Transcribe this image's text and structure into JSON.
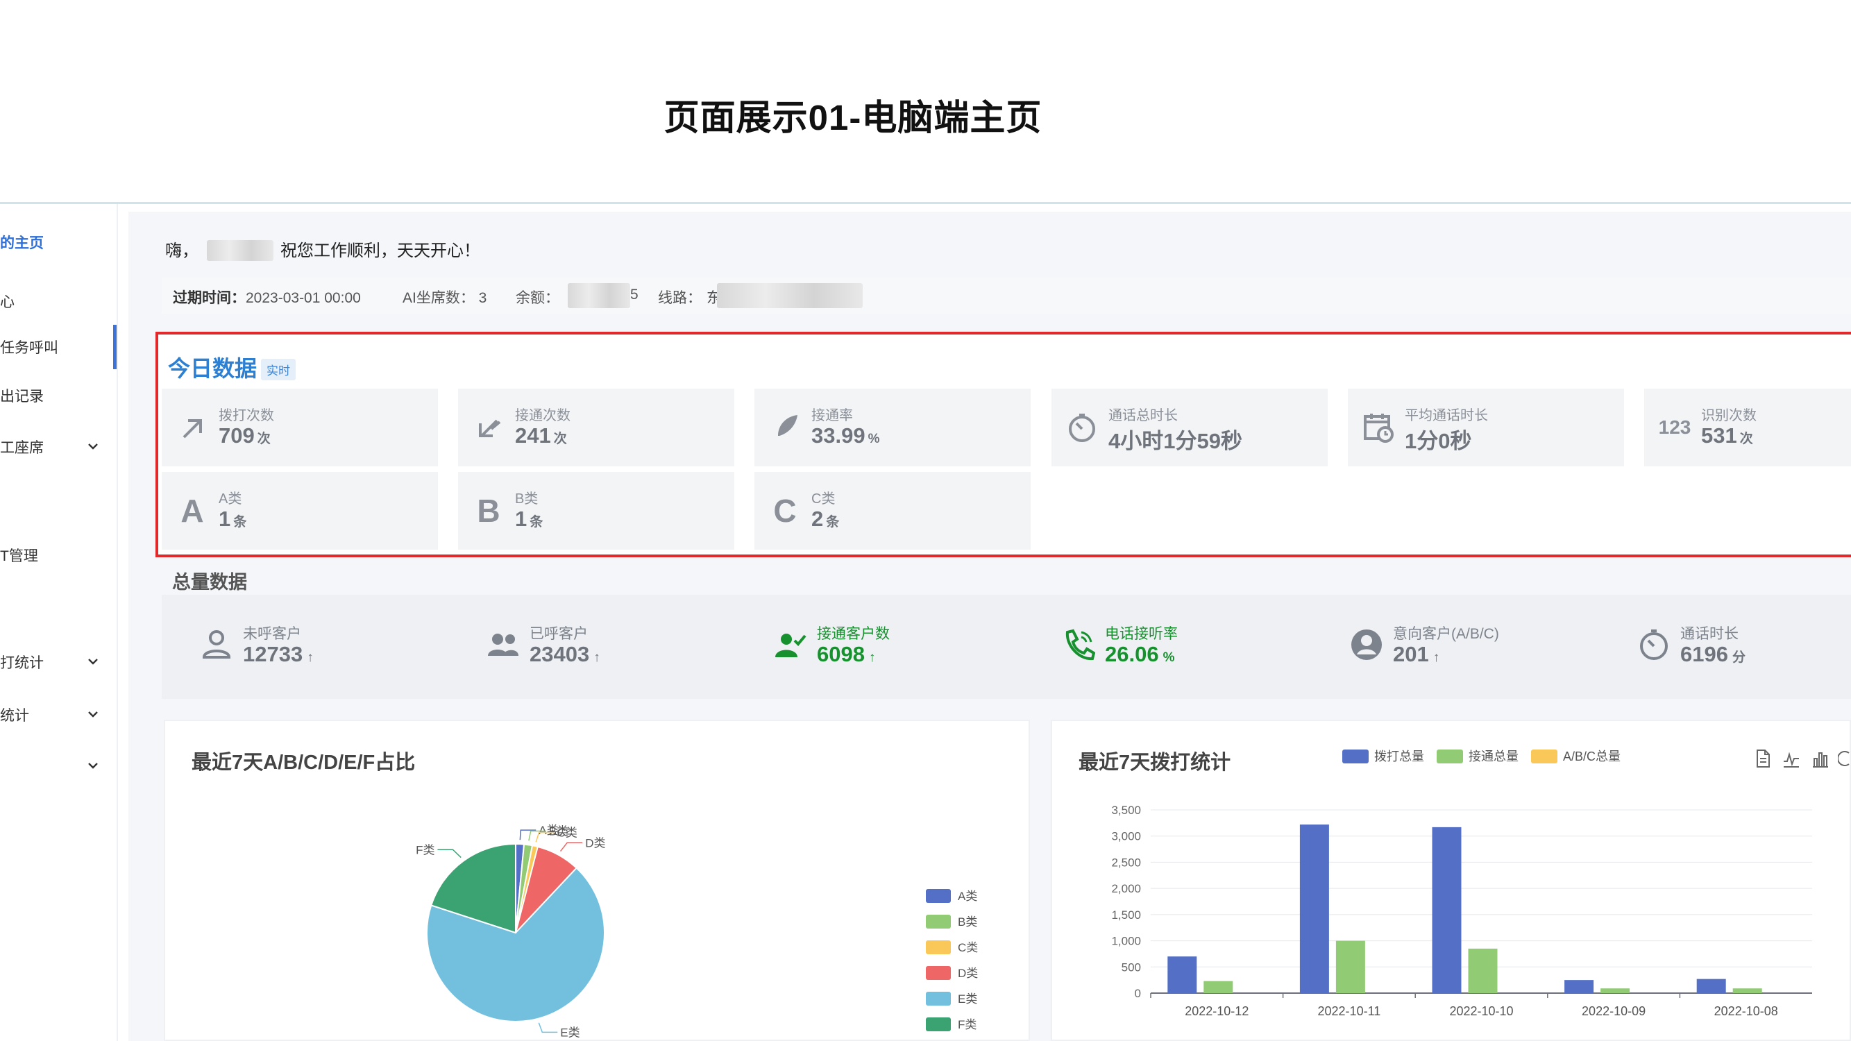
{
  "slide_title": "页面展示01-电脑端主页",
  "sidebar": {
    "items": [
      {
        "label": "的主页",
        "active": true
      },
      {
        "label": "心"
      },
      {
        "label": "任务呼叫"
      },
      {
        "label": "出记录"
      },
      {
        "label": "工座席",
        "has_chevron": true
      },
      {
        "label": "T管理"
      },
      {
        "label": "打统计",
        "has_chevron": true
      },
      {
        "label": "统计",
        "has_chevron": true
      },
      {
        "label": "",
        "has_chevron": true
      }
    ]
  },
  "greeting": {
    "prefix": "嗨，",
    "suffix": "祝您工作顺利，天天开心！"
  },
  "info": {
    "expire_label": "过期时间：",
    "expire_value": "2023-03-01 00:00",
    "seats": "AI坐席数： 3",
    "balance_label": "余额：",
    "balance_tail": "5",
    "line_label": "线路：",
    "line_tail": "东"
  },
  "today": {
    "title": "今日数据",
    "badge": "实时",
    "cards": [
      {
        "icon": "arrow-up-right-icon",
        "label": "拨打次数",
        "value": "709",
        "unit": "次"
      },
      {
        "icon": "arrow-down-left-icon",
        "label": "接通次数",
        "value": "241",
        "unit": "次"
      },
      {
        "icon": "feather-icon",
        "label": "接通率",
        "value": "33.99",
        "unit": "%"
      },
      {
        "icon": "timer-icon",
        "label": "通话总时长",
        "value": "4小时1分59秒",
        "unit": ""
      },
      {
        "icon": "calendar-clock-icon",
        "label": "平均通话时长",
        "value": "1分0秒",
        "unit": ""
      },
      {
        "icon": "numbers-icon",
        "glyph": "123",
        "label": "识别次数",
        "value": "531",
        "unit": "次"
      },
      {
        "icon": "letter-a-icon",
        "glyph": "A",
        "label": "A类",
        "value": "1",
        "unit": "条"
      },
      {
        "icon": "letter-b-icon",
        "glyph": "B",
        "label": "B类",
        "value": "1",
        "unit": "条"
      },
      {
        "icon": "letter-c-icon",
        "glyph": "C",
        "label": "C类",
        "value": "2",
        "unit": "条"
      }
    ]
  },
  "totals": {
    "title": "总量数据",
    "items": [
      {
        "icon": "user-icon",
        "label": "未呼客户",
        "value": "12733",
        "unit": "↑"
      },
      {
        "icon": "users-icon",
        "label": "已呼客户",
        "value": "23403",
        "unit": "↑"
      },
      {
        "icon": "user-check-icon",
        "label": "接通客户数",
        "value": "6098",
        "unit": "↑",
        "green": true
      },
      {
        "icon": "phone-icon",
        "label": "电话接听率",
        "value": "26.06",
        "unit": "%",
        "green": true
      },
      {
        "icon": "user-circle-icon",
        "label": "意向客户(A/B/C)",
        "value": "201",
        "unit": "↑"
      },
      {
        "icon": "timer-icon",
        "label": "通话时长",
        "value": "6196",
        "unit": "分"
      }
    ]
  },
  "pie_panel": {
    "title": "最近7天A/B/C/D/E/F占比"
  },
  "bar_panel": {
    "title": "最近7天拨打统计"
  },
  "colors": {
    "accent": "#2d7fd2",
    "highlight_border": "#e0292a",
    "green": "#16912e",
    "series_blue": "#5470c6",
    "series_green": "#91cc75",
    "series_yellow": "#fac858"
  },
  "chart_data": [
    {
      "type": "pie",
      "title": "最近7天A/B/C/D/E/F占比",
      "categories": [
        "A类",
        "B类",
        "C类",
        "D类",
        "E类",
        "F类"
      ],
      "values": [
        1.5,
        1.5,
        1,
        8,
        68,
        20
      ],
      "colors": [
        "#5470c6",
        "#91cc75",
        "#fac858",
        "#ee6666",
        "#73c0de",
        "#3ba272"
      ],
      "legend": "right"
    },
    {
      "type": "bar",
      "title": "最近7天拨打统计",
      "categories": [
        "2022-10-12",
        "2022-10-11",
        "2022-10-10",
        "2022-10-09",
        "2022-10-08"
      ],
      "series": [
        {
          "name": "拨打总量",
          "values": [
            700,
            3220,
            3170,
            250,
            270
          ],
          "color": "#5470c6"
        },
        {
          "name": "接通总量",
          "values": [
            230,
            1000,
            850,
            90,
            90
          ],
          "color": "#91cc75"
        },
        {
          "name": "A/B/C总量",
          "values": [
            0,
            0,
            0,
            0,
            0
          ],
          "color": "#fac858"
        }
      ],
      "ylim": [
        0,
        3500
      ],
      "yticks": [
        "0",
        "500",
        "1,000",
        "1,500",
        "2,000",
        "2,500",
        "3,000",
        "3,500"
      ],
      "legend": "top",
      "grid": true
    }
  ]
}
